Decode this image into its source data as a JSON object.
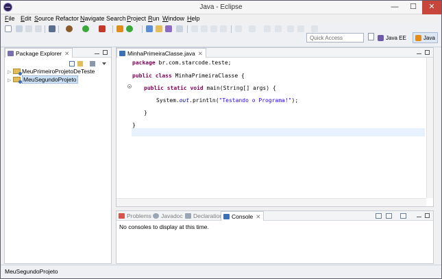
{
  "window": {
    "title": "Java - Eclipse",
    "min_glyph": "—",
    "max_glyph": "☐",
    "close_glyph": "✕"
  },
  "menu": [
    {
      "mnemonic": "F",
      "rest": "ile"
    },
    {
      "mnemonic": "E",
      "rest": "dit"
    },
    {
      "mnemonic": "S",
      "rest": "ource"
    },
    {
      "mnemonic": "R",
      "rest": "efactor",
      "prefix": "Refac",
      "label": "Refactor"
    },
    {
      "mnemonic": "N",
      "rest": "avigate"
    },
    {
      "mnemonic": "S",
      "rest": "earch",
      "prefix": "Se",
      "label": "Search"
    },
    {
      "mnemonic": "P",
      "rest": "roject"
    },
    {
      "mnemonic": "R",
      "rest": "un"
    },
    {
      "mnemonic": "W",
      "rest": "indow"
    },
    {
      "mnemonic": "H",
      "rest": "elp"
    }
  ],
  "toolbar": {
    "quick_access": "Quick Access",
    "perspectives": [
      {
        "label": "Java EE",
        "icon": "java-ee-icon",
        "active": false
      },
      {
        "label": "Java",
        "icon": "java-perspective-icon",
        "active": true
      }
    ],
    "colors": {
      "accent": "#3d6fb4",
      "run": "#3aa83a",
      "debug": "#8b5a2b"
    }
  },
  "package_explorer": {
    "tab_label": "Package Explorer",
    "projects": [
      {
        "name": "MeuPrimeiroProjetoDeTeste",
        "selected": false
      },
      {
        "name": "MeuSegundoProjeto",
        "selected": true
      }
    ]
  },
  "editor": {
    "tab_label": "MinhaPrimeiraClasse.java",
    "code": {
      "package_kw": "package",
      "package_name": " br.com.starcode.teste;",
      "public_kw": "public",
      "class_kw": " class",
      "class_name": " MinhaPrimeiraClasse {",
      "main_public": "public",
      "main_static": " static",
      "main_void": " void",
      "main_sig": " main(String[] args) {",
      "println_prefix": "System.",
      "println_out": "out",
      "println_mid": ".println(",
      "println_str": "\"Testando o Programa!\"",
      "println_end": ");",
      "close_method": "}",
      "close_class": "}"
    }
  },
  "bottom_panel": {
    "tabs": [
      {
        "label": "Problems",
        "active": false
      },
      {
        "label": "Javadoc",
        "active": false
      },
      {
        "label": "Declaration",
        "active": false
      },
      {
        "label": "Console",
        "active": true
      }
    ],
    "message": "No consoles to display at this time."
  },
  "status_bar": {
    "text": "MeuSegundoProjeto"
  }
}
